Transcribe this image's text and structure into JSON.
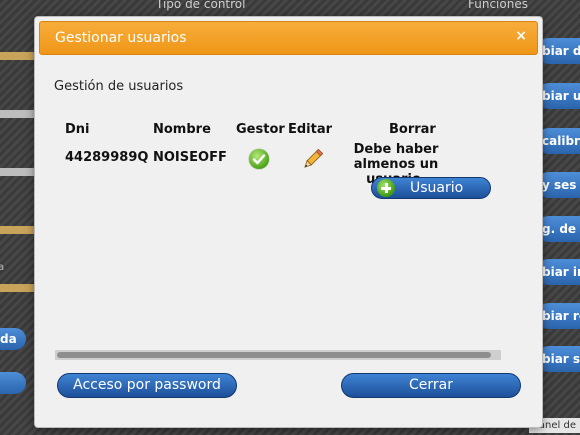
{
  "background": {
    "top_labels": [
      "Tipo de control",
      "Funciones"
    ],
    "right_buttons": [
      "biar da",
      "biar us",
      "calibra",
      "y ses",
      "g. de",
      "biar inf",
      "biar re",
      "biar ses"
    ],
    "left_buttons": [
      "da",
      ""
    ],
    "left_text": "a",
    "panel_label": "Panel de"
  },
  "dialog": {
    "title": "Gestionar usuarios",
    "close_glyph": "×",
    "section_title": "Gestión de usuarios",
    "table": {
      "headers": [
        "Dni",
        "Nombre",
        "Gestor",
        "Editar",
        "Borrar"
      ],
      "rows": [
        {
          "dni": "44289989Q",
          "nombre": "NOISEOFF",
          "gestor": "check-icon",
          "editar": "pencil-icon",
          "borrar": "Debe haber almenos un usuario."
        }
      ]
    },
    "add_user_button": "Usuario",
    "footer": {
      "password_button": "Acceso por password",
      "close_button": "Cerrar"
    }
  },
  "colors": {
    "title_bar": "#f29d22",
    "button_blue": "#2a64ad",
    "dialog_bg": "#f0f0f0"
  }
}
